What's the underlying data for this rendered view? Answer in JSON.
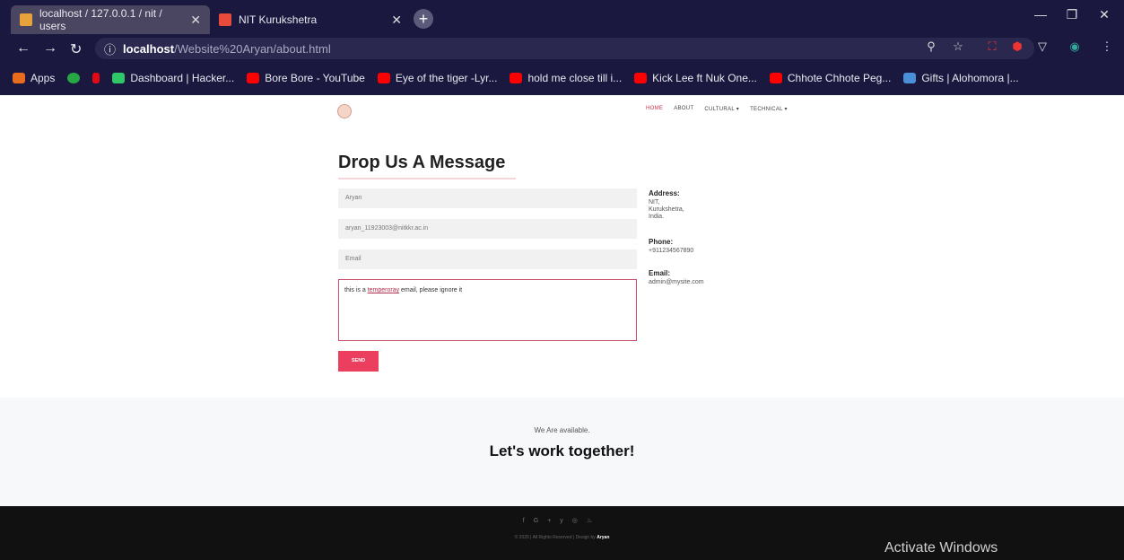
{
  "browser": {
    "tabs": [
      {
        "label": "localhost / 127.0.0.1 / nit / users",
        "active": false,
        "favicon_color": "#e8a23b"
      },
      {
        "label": "NIT Kurukshetra",
        "active": true,
        "favicon_color": "#e84a3b"
      }
    ],
    "address": {
      "host": "localhost",
      "path": "/Website%20Aryan/about.html",
      "info_icon": "info-icon"
    },
    "bookmarks": [
      {
        "label": "Apps",
        "icon_color": "#e86c1d"
      },
      {
        "label": "",
        "icon_color": "#27a844"
      },
      {
        "label": "",
        "icon_color": "#e50914"
      },
      {
        "label": "Dashboard | Hacker...",
        "icon_color": "#2ec866"
      },
      {
        "label": "Bore Bore - YouTube",
        "icon_color": "#ff0000"
      },
      {
        "label": "Eye of the tiger -Lyr...",
        "icon_color": "#ff0000"
      },
      {
        "label": "hold me close till i...",
        "icon_color": "#ff0000"
      },
      {
        "label": "Kick Lee ft Nuk One...",
        "icon_color": "#ff0000"
      },
      {
        "label": "Chhote Chhote Peg...",
        "icon_color": "#ff0000"
      },
      {
        "label": "Gifts | Alohomora |...",
        "icon_color": "#4a90d9"
      }
    ]
  },
  "site": {
    "nav": [
      {
        "label": "HOME",
        "active": true
      },
      {
        "label": "ABOUT",
        "active": false
      },
      {
        "label": "CULTURAL ▾",
        "active": false
      },
      {
        "label": "TECHNICAL ▾",
        "active": false
      }
    ],
    "heading": "Drop Us A Message",
    "form": {
      "name_value": "Aryan",
      "email_value": "aryan_11923003@nitkkr.ac.in",
      "subject_placeholder": "Email",
      "message_prefix": "this is a ",
      "message_misspelled": "temperoray",
      "message_suffix": " email, please ignore it",
      "send_label": "SEND"
    },
    "contact": {
      "address_label": "Address:",
      "address_lines": [
        "NIT,",
        "Kurukshetra,",
        "India."
      ],
      "phone_label": "Phone:",
      "phone": "+911234567890",
      "email_label": "Email:",
      "email": "admin@mysite.com"
    },
    "cta": {
      "small": "We Are available.",
      "big": "Let's work together!"
    },
    "footer": {
      "social": [
        "f",
        "G+",
        "y",
        "◎",
        "♨"
      ],
      "copyright_prefix": "© 2020 | All Rights Reserved | Design by ",
      "author": "Aryan"
    }
  },
  "os": {
    "watermark": "Activate Windows"
  }
}
